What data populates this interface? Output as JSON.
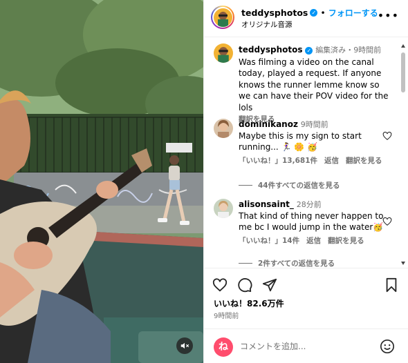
{
  "header": {
    "username": "teddysphotos",
    "verified_icon": "verified-badge-icon",
    "separator": "•",
    "follow_label": "フォローする",
    "subtitle": "オリジナル音源",
    "more_icon": "more-options-icon"
  },
  "caption": {
    "username": "teddysphotos",
    "edited": "編集済み",
    "separator": "・",
    "time": "9時間前",
    "text": "Was filming a video on the canal today, played a request. If anyone knows the runner lemme know so we can have their POV video for the lols",
    "translate_label": "翻訳を見る"
  },
  "comments": [
    {
      "username": "dominikanoz",
      "time": "9時間前",
      "text": "Maybe this is my sign to start running... 🏃‍♀️ 🌼 🥳",
      "like_label": "「いいね！」13,681件",
      "reply_label": "返信",
      "translate_label": "翻訳を見る",
      "replies_label": "44件すべての返信を見る"
    },
    {
      "username": "alisonsaint_",
      "time": "28分前",
      "text": "That kind of thing never happen to me bc I would jump in the water🥳",
      "like_label": "「いいね！」14件",
      "reply_label": "返信",
      "translate_label": "翻訳を見る",
      "replies_label": "2件すべての返信を見る"
    }
  ],
  "post_footer": {
    "likes": "いいね！82.6万件",
    "time": "9時間前"
  },
  "comment_box": {
    "avatar_letter": "ね",
    "placeholder": "コメントを追加..."
  },
  "colors": {
    "accent": "#0095f6",
    "muted": "#737373",
    "border": "#efefef"
  },
  "icons": [
    "heart-icon",
    "comment-icon",
    "share-icon",
    "bookmark-icon",
    "emoji-icon",
    "mute-icon"
  ]
}
